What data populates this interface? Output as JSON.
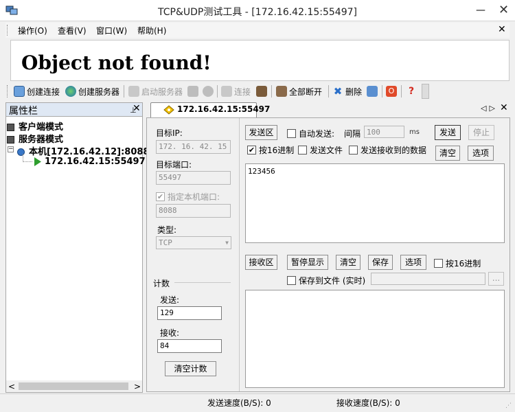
{
  "window": {
    "title": "TCP&UDP测试工具 - [172.16.42.15:55497]",
    "minimize": "—",
    "close": "✕"
  },
  "menu": {
    "items": [
      "操作(O)",
      "查看(V)",
      "窗口(W)",
      "帮助(H)"
    ],
    "close": "✕"
  },
  "banner": {
    "text": "Object not found!"
  },
  "toolbar": {
    "create_connection": "创建连接",
    "create_server": "创建服务器",
    "start_server": "启动服务器",
    "connect": "连接",
    "disconnect_all": "全部断开",
    "delete": "删除"
  },
  "left_panel": {
    "title": "属性栏",
    "pin": "📌",
    "close": "✕",
    "tree": {
      "client_mode": "客户端模式",
      "server_mode": "服务器模式",
      "local": "本机[172.16.42.12]:8088",
      "connection": "172.16.42.15:55497"
    },
    "scroll_left": "<",
    "scroll_right": ">"
  },
  "tab": {
    "label": "172.16.42.15:55497",
    "nav": "◁▷",
    "close": "✕"
  },
  "form": {
    "target_ip_label": "目标IP:",
    "target_ip": "172. 16. 42. 15",
    "target_port_label": "目标端口:",
    "target_port": "55497",
    "local_port_checkbox": "指定本机端口:",
    "local_port": "8088",
    "type_label": "类型:",
    "type_value": "TCP",
    "count_label": "计数",
    "send_label": "发送:",
    "send_count": "129",
    "recv_label": "接收:",
    "recv_count": "84",
    "clear_count": "清空计数"
  },
  "send_area": {
    "title": "发送区",
    "auto_send": "自动发送:",
    "interval_label": "间隔",
    "interval_value": "100",
    "interval_unit": "ms",
    "send_button": "发送",
    "stop_button": "停止",
    "hex_checkbox": "按16进制",
    "hex_checked": true,
    "send_file": "发送文件",
    "send_received": "发送接收到的数据",
    "clear_button": "清空",
    "options_button": "选项",
    "content": "123456"
  },
  "recv_area": {
    "title": "接收区",
    "pause_display": "暂停显示",
    "clear": "清空",
    "save": "保存",
    "options": "选项",
    "hex_checkbox": "按16进制",
    "save_to_file": "保存到文件 (实时)",
    "browse": "...",
    "content": ""
  },
  "status": {
    "send_speed": "发送速度(B/S): 0",
    "recv_speed": "接收速度(B/S): 0"
  },
  "colors": {
    "panel_header": "#dfe8f4",
    "tree_arrow": "#2e9e2e",
    "close_icon_red": "#d42a1f"
  }
}
